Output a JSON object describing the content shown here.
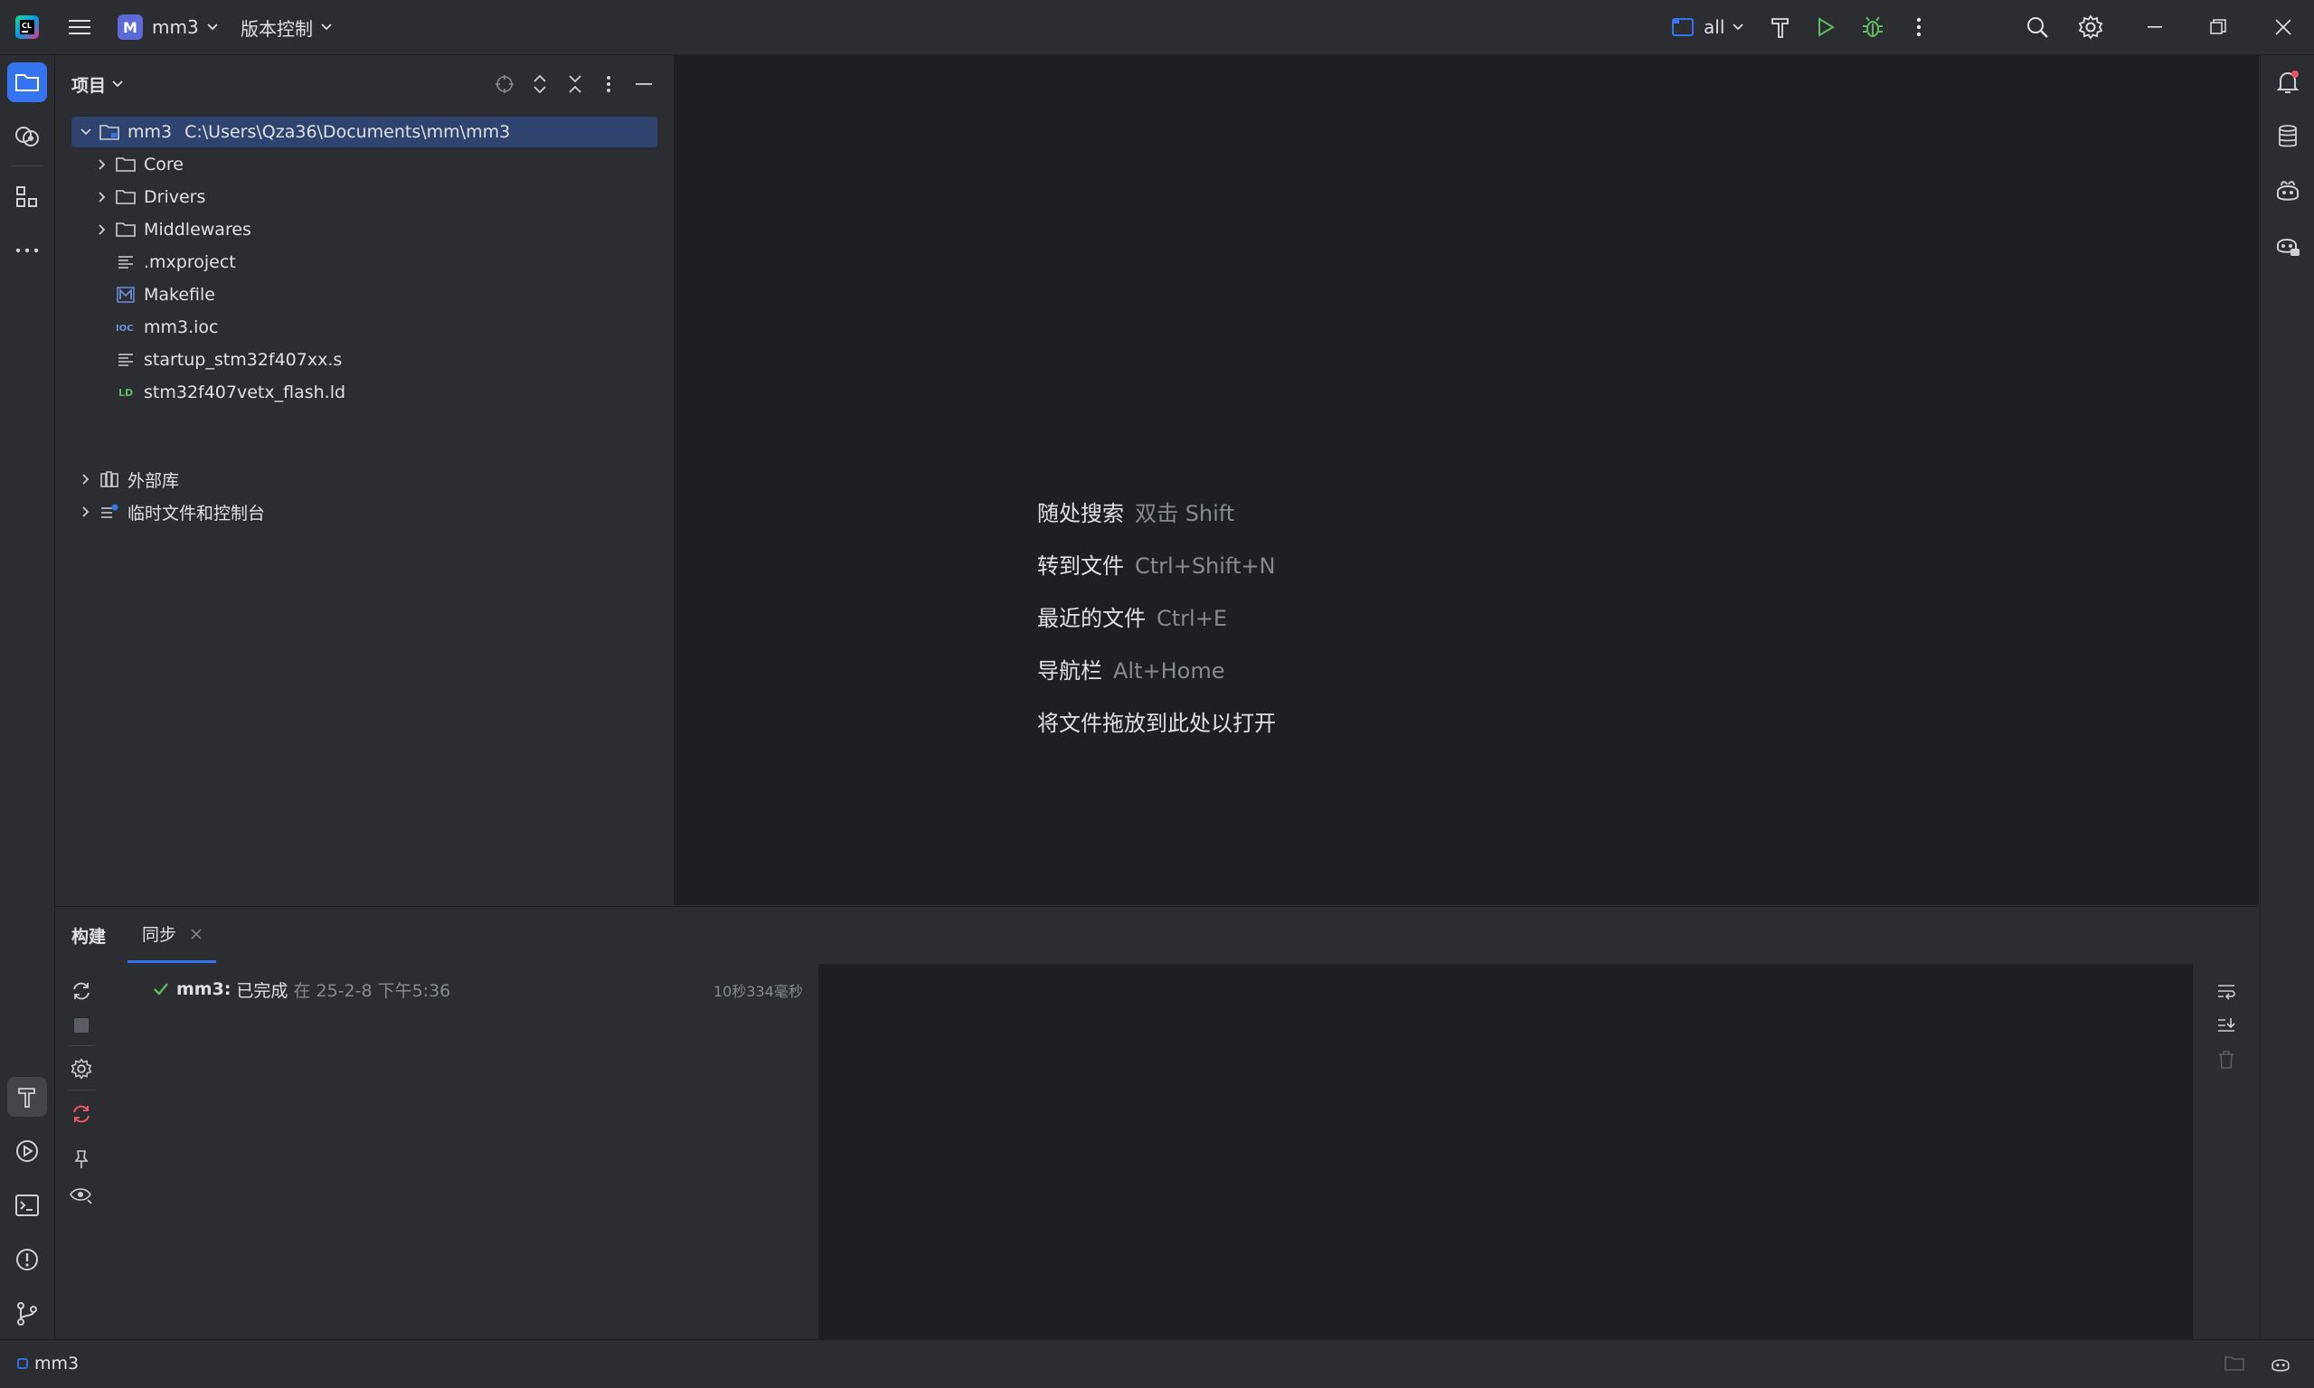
{
  "titlebar": {
    "project_badge": "M",
    "project_name": "mm3",
    "vcs_label": "版本控制",
    "run_config": "all"
  },
  "project_panel": {
    "title": "项目",
    "root": {
      "name": "mm3",
      "path": "C:\\Users\\Qza36\\Documents\\mm\\mm3"
    },
    "items": [
      {
        "name": "Core",
        "type": "folder"
      },
      {
        "name": "Drivers",
        "type": "folder"
      },
      {
        "name": "Middlewares",
        "type": "folder"
      },
      {
        "name": ".mxproject",
        "type": "text-file"
      },
      {
        "name": "Makefile",
        "type": "makefile"
      },
      {
        "name": "mm3.ioc",
        "type": "ioc-file"
      },
      {
        "name": "startup_stm32f407xx.s",
        "type": "text-file"
      },
      {
        "name": "stm32f407vetx_flash.ld",
        "type": "ld-file"
      }
    ],
    "external_libs": "外部库",
    "scratches": "临时文件和控制台"
  },
  "editor_hints": [
    {
      "label": "随处搜索",
      "key": "双击 Shift"
    },
    {
      "label": "转到文件",
      "key": "Ctrl+Shift+N"
    },
    {
      "label": "最近的文件",
      "key": "Ctrl+E"
    },
    {
      "label": "导航栏",
      "key": "Alt+Home"
    },
    {
      "label": "将文件拖放到此处以打开",
      "key": ""
    }
  ],
  "bottom_panel": {
    "tab_build": "构建",
    "tab_sync": "同步",
    "build_result": {
      "project": "mm3:",
      "status": "已完成",
      "time": "在 25-2-8 下午5:36",
      "duration": "10秒334毫秒"
    }
  },
  "statusbar": {
    "project": "mm3"
  },
  "colors": {
    "accent": "#3574f0",
    "success": "#5fb865",
    "error": "#e55765",
    "selection": "#2e436e"
  }
}
